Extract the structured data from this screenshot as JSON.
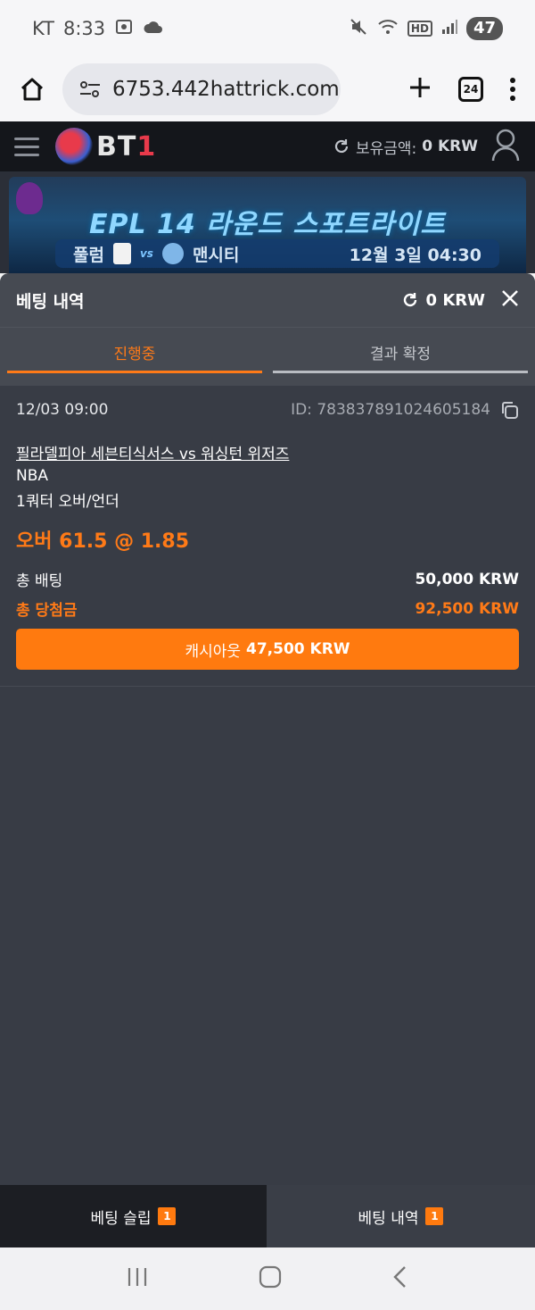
{
  "status_bar": {
    "carrier": "KT",
    "time": "8:33",
    "hd_label": "HD",
    "battery": "47"
  },
  "browser": {
    "url": "6753.442hattrick.com",
    "tab_count": "24"
  },
  "site": {
    "logo_main": "BT",
    "logo_accent": "1",
    "balance_label": "보유금액:",
    "balance_value": "0 KRW"
  },
  "banner": {
    "title": "EPL 14 라운드 스포트라이트",
    "home_team": "풀럼",
    "vs": "vs",
    "away_team": "맨시티",
    "date": "12월 3일 04:30"
  },
  "bet_panel": {
    "title": "베팅 내역",
    "balance": "0 KRW",
    "tabs": [
      {
        "label": "진행중",
        "active": true
      },
      {
        "label": "결과 확정",
        "active": false
      }
    ],
    "bets": [
      {
        "datetime": "12/03 09:00",
        "id": "ID: 783837891024605184",
        "match": "필라델피아 세븐티식서스 vs 워싱턴 위저즈",
        "league": "NBA",
        "market": "1쿼터 오버/언더",
        "pick": "오버 61.5 @ 1.85",
        "total_bet_label": "총 배팅",
        "total_bet_value": "50,000 KRW",
        "total_win_label": "총 당첨금",
        "total_win_value": "92,500 KRW",
        "cashout_label": "캐시아웃",
        "cashout_value": "47,500 KRW"
      }
    ]
  },
  "bottom_tabs": {
    "slip_label": "베팅 슬립",
    "slip_count": "1",
    "history_label": "베팅 내역",
    "history_count": "1"
  },
  "colors": {
    "accent": "#ff7a17",
    "panel": "#383c45",
    "header": "#14161b"
  }
}
